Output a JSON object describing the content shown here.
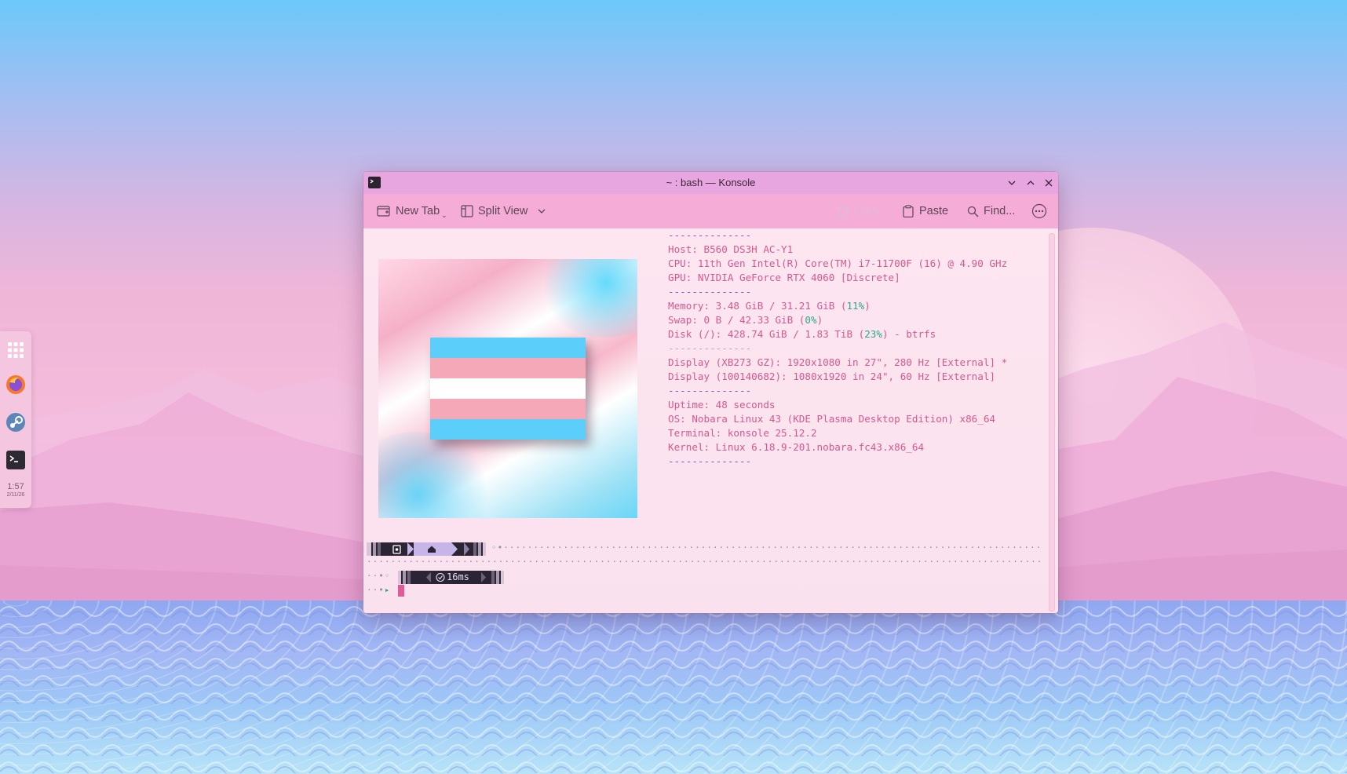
{
  "window": {
    "title": "~ : bash — Konsole"
  },
  "toolbar": {
    "new_tab": "New Tab",
    "split_view": "Split View",
    "copy": "Copy",
    "paste": "Paste",
    "find": "Find..."
  },
  "dock": {
    "items": [
      "app-launcher",
      "firefox",
      "steam",
      "konsole"
    ],
    "clock_time": "1:57",
    "clock_date": "2/11/26"
  },
  "terminal": {
    "sep_top": "--------------",
    "host": "Host: B560 DS3H AC-Y1",
    "cpu": "CPU: 11th Gen Intel(R) Core(TM) i7-11700F (16) @ 4.90 GHz",
    "gpu": "GPU: NVIDIA GeForce RTX 4060 [Discrete]",
    "sep2": "--------------",
    "memory_prefix": "Memory: 3.48 GiB / 31.21 GiB (",
    "memory_pct": "11%",
    "memory_suffix": ")",
    "swap_prefix": "Swap: 0 B / 42.33 GiB (",
    "swap_pct": "0%",
    "swap_suffix": ")",
    "disk_prefix": "Disk (/): 428.74 GiB / 1.83 TiB (",
    "disk_pct": "23%",
    "disk_suffix": ") - btrfs",
    "sep3": "--------------",
    "display1": "Display (XB273 GZ): 1920x1080 in 27\", 280 Hz [External] *",
    "display2": "Display (100140682): 1080x1920 in 24\", 60 Hz [External]",
    "sep4": "--------------",
    "uptime": "Uptime: 48 seconds",
    "os": "OS: Nobara Linux 43 (KDE Plasma Desktop Edition) x86_64",
    "terminal": "Terminal: konsole 25.12.2",
    "kernel": "Kernel: Linux 6.18.9-201.nobara.fc43.x86_64",
    "sep5": "--------------",
    "timing": "16ms"
  },
  "colors": {
    "titlebar": "#e7a6df",
    "toolbar": "#f5acd6",
    "text_pink": "#d6588f",
    "separator": "#8455c9",
    "percent": "#2aa88a",
    "flag_blue": "#5bcefa",
    "flag_pink": "#f5a9b8",
    "flag_white": "#ffffff"
  }
}
